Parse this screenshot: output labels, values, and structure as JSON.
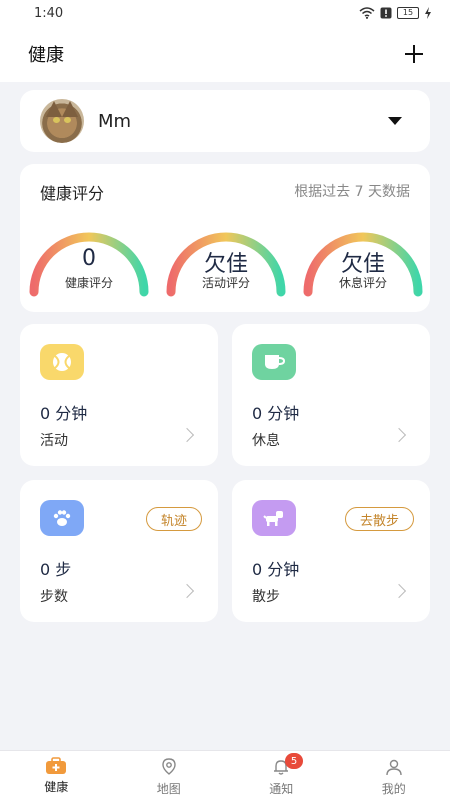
{
  "status_bar": {
    "time": "1:40",
    "battery": "15"
  },
  "header": {
    "title": "健康"
  },
  "pet": {
    "name": "Mm"
  },
  "score": {
    "title": "健康评分",
    "subtitle": "根据过去 7 天数据",
    "gauges": [
      {
        "value": "0",
        "label": "健康评分"
      },
      {
        "value": "欠佳",
        "label": "活动评分"
      },
      {
        "value": "欠佳",
        "label": "休息评分"
      }
    ]
  },
  "tiles": [
    {
      "value": "0 分钟",
      "label": "活动",
      "icon": "tennis-ball-icon",
      "color": "#f9d86b"
    },
    {
      "value": "0 分钟",
      "label": "休息",
      "icon": "cup-icon",
      "color": "#6fd3a0"
    },
    {
      "value": "0 步",
      "label": "步数",
      "icon": "paw-icon",
      "color": "#7fa8f6",
      "tag": "轨迹"
    },
    {
      "value": "0 分钟",
      "label": "散步",
      "icon": "dog-icon",
      "color": "#c49bf1",
      "tag": "去散步"
    }
  ],
  "tabs": [
    {
      "label": "健康",
      "icon": "medical-kit-icon"
    },
    {
      "label": "地图",
      "icon": "map-pin-icon"
    },
    {
      "label": "通知",
      "icon": "bell-icon",
      "badge": "5"
    },
    {
      "label": "我的",
      "icon": "person-icon"
    }
  ],
  "colors": {
    "gauge_start": "#ee6b6b",
    "gauge_mid": "#f1c75a",
    "gauge_end": "#3fd6a9",
    "tag": "#d59a3f"
  }
}
